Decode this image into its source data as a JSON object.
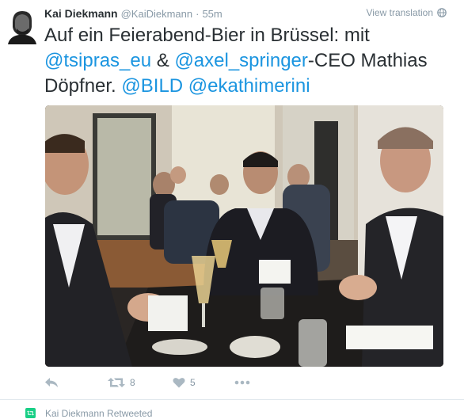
{
  "tweet": {
    "fullname": "Kai Diekmann",
    "username": "@KaiDiekmann",
    "separator": "·",
    "time": "55m",
    "view_translation": "View translation",
    "text": {
      "part1": "Auf ein Feierabend-Bier in Brüssel: mit ",
      "mention1": "@tsipras_eu",
      "part2": " & ",
      "mention2": "@axel_springer",
      "part3": "-CEO Mathias Döpfner. ",
      "mention3": "@BILD",
      "part4": " ",
      "mention4": "@ekathimerini"
    },
    "photo": {
      "description_icon": "photo-of-meeting-in-restaurant"
    },
    "actions": {
      "reply_icon": "reply-icon",
      "retweet_icon": "retweet-icon",
      "retweet_count": "8",
      "like_icon": "heart-icon",
      "like_count": "5",
      "more_icon": "more-icon"
    }
  },
  "next_context": {
    "icon": "retweet-badge-icon",
    "text": "Kai Diekmann Retweeted"
  },
  "colors": {
    "link": "#1b95e0",
    "muted": "#8899a6",
    "action_icon": "#aab8c2",
    "retweet_badge": "#19cf86",
    "text": "#292f33"
  }
}
